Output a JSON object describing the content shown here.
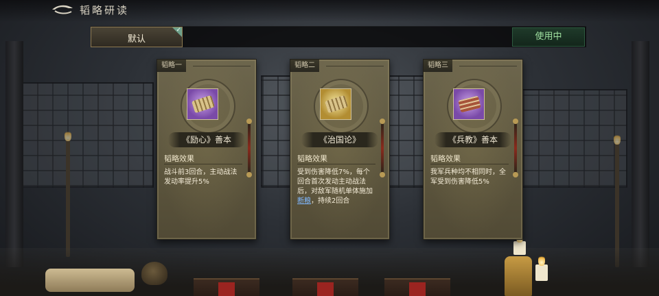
{
  "header": {
    "title": "韬略研读",
    "back_icon": "back-arrow-icon"
  },
  "strategy_bar": {
    "default_tab_label": "默认",
    "in_use_label": "使用中",
    "check_icon": "checkmark-icon",
    "colors": {
      "in_use_text": "#9fe0a0",
      "check": "#6ea08a"
    }
  },
  "cards": [
    {
      "tag": "韬略一",
      "name": "《励心》善本",
      "icon": "bamboo-scroll-icon",
      "icon_bg": "purple",
      "effect_title": "韬略效果",
      "effect_text": "战斗前3回合，主动战法发动率提升5%"
    },
    {
      "tag": "韬略二",
      "name": "《治国论》",
      "icon": "bamboo-scroll-icon",
      "icon_bg": "gold",
      "effect_title": "韬略效果",
      "effect_text_before": "受到伤害降低7%，每个回合首次发动主动战法后，对敌军随机单体施加",
      "effect_link": "断粮",
      "effect_text_after": "，持续2回合"
    },
    {
      "tag": "韬略三",
      "name": "《兵教》善本",
      "icon": "book-icon",
      "icon_bg": "purple",
      "effect_title": "韬略效果",
      "effect_text": "我军兵种均不相同时，全军受到伤害降低5%"
    }
  ]
}
